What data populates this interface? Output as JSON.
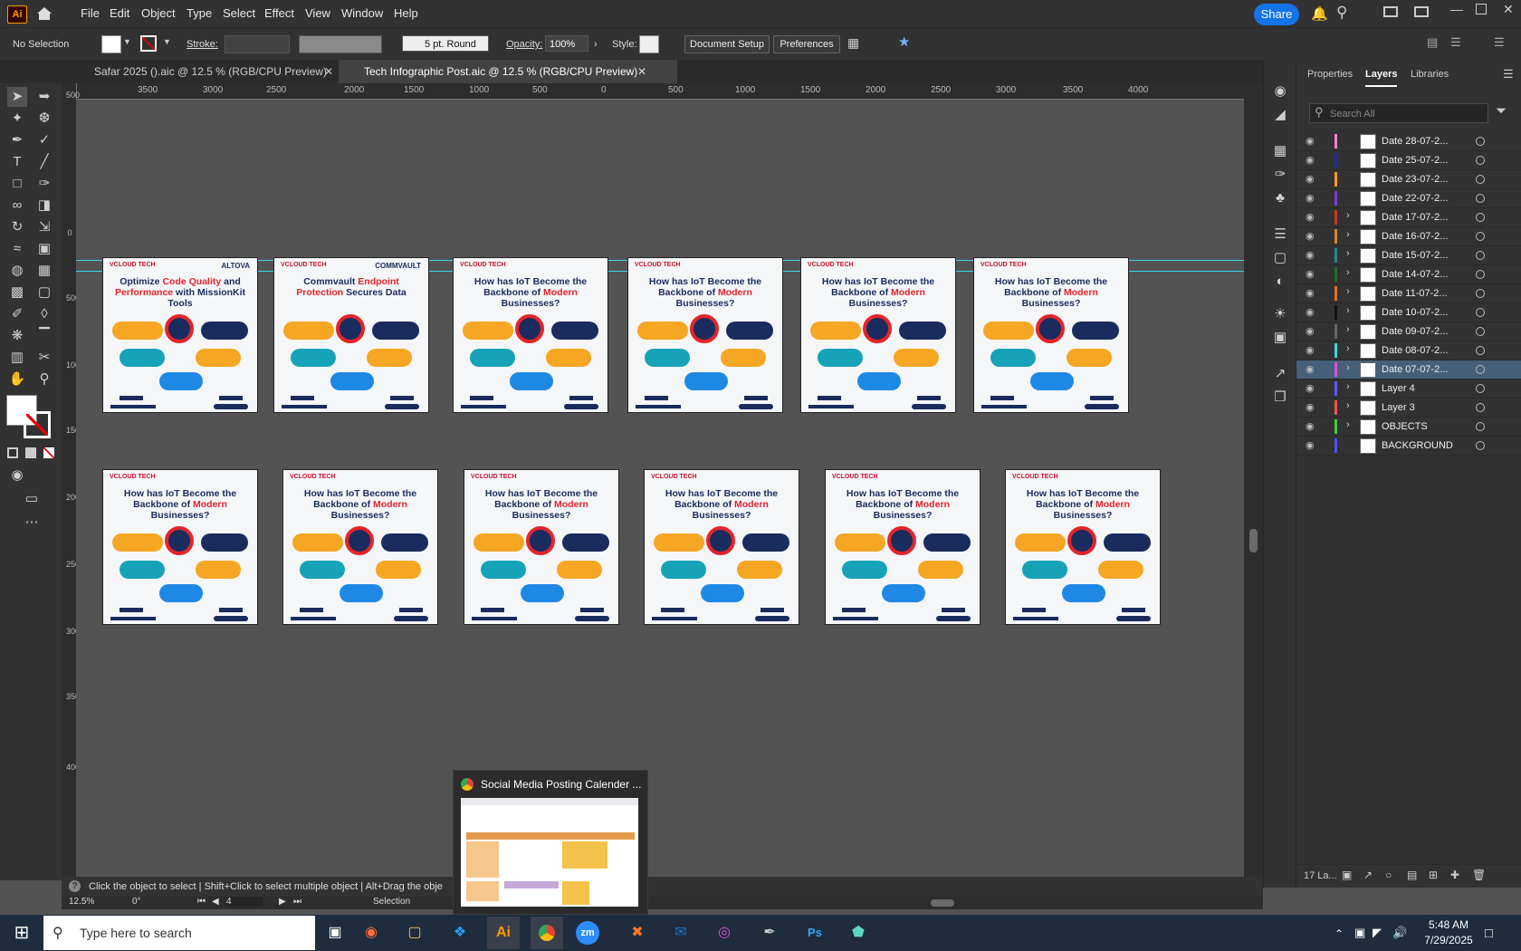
{
  "app": {
    "logo": "Ai"
  },
  "menu": [
    "File",
    "Edit",
    "Object",
    "Type",
    "Select",
    "Effect",
    "View",
    "Window",
    "Help"
  ],
  "header": {
    "share_label": "Share"
  },
  "control_bar": {
    "selection": "No Selection",
    "stroke_label": "Stroke:",
    "brush": "5 pt. Round",
    "opacity_label": "Opacity:",
    "opacity_value": "100%",
    "style_label": "Style:",
    "document_setup": "Document Setup",
    "preferences": "Preferences"
  },
  "tabs": [
    {
      "label": "Safar 2025 ().aic @ 12.5 % (RGB/CPU Preview)",
      "active": false
    },
    {
      "label": "Tech Infographic Post.aic @ 12.5 % (RGB/CPU Preview)",
      "active": true
    }
  ],
  "ruler_h": [
    "3500",
    "3000",
    "2500",
    "2000",
    "1500",
    "1000",
    "500",
    "0",
    "500",
    "1000",
    "1500",
    "2000",
    "2500",
    "3000",
    "3500",
    "4000"
  ],
  "ruler_v": [
    "500",
    "0",
    "500",
    "1000",
    "1500",
    "2000",
    "2500",
    "3000",
    "3500",
    "4000"
  ],
  "artboards_row1": [
    {
      "logo": "VCLOUD TECH",
      "brand": "ALTOVA",
      "title_a": "Optimize ",
      "title_red": "Code Quality",
      "title_b": " and ",
      "title_red2": "Performance",
      "title_c": " with MissionKit Tools"
    },
    {
      "logo": "VCLOUD TECH",
      "brand": "COMMVAULT",
      "title_a": "Commvault ",
      "title_red": "Endpoint Protection",
      "title_b": " Secures Data",
      "title_red2": "",
      "title_c": ""
    },
    {
      "logo": "VCLOUD TECH",
      "brand": "",
      "title_a": "How has IoT Become the Backbone of ",
      "title_red": "Modern",
      "title_b": " Businesses?",
      "title_red2": "",
      "title_c": ""
    },
    {
      "logo": "VCLOUD TECH",
      "brand": "",
      "title_a": "How has IoT Become the Backbone of ",
      "title_red": "Modern",
      "title_b": " Businesses?",
      "title_red2": "",
      "title_c": ""
    },
    {
      "logo": "VCLOUD TECH",
      "brand": "",
      "title_a": "How has IoT Become the Backbone of ",
      "title_red": "Modern",
      "title_b": " Businesses?",
      "title_red2": "",
      "title_c": ""
    },
    {
      "logo": "VCLOUD TECH",
      "brand": "",
      "title_a": "How has IoT Become the Backbone of ",
      "title_red": "Modern",
      "title_b": " Businesses?",
      "title_red2": "",
      "title_c": ""
    }
  ],
  "artboards_row2": [
    {
      "logo": "VCLOUD TECH",
      "title_a": "How has IoT Become the Backbone of ",
      "title_red": "Modern",
      "title_b": " Businesses?"
    },
    {
      "logo": "VCLOUD TECH",
      "title_a": "How has IoT Become the Backbone of ",
      "title_red": "Modern",
      "title_b": " Businesses?"
    },
    {
      "logo": "VCLOUD TECH",
      "title_a": "How has IoT Become the Backbone of ",
      "title_red": "Modern",
      "title_b": " Businesses?"
    },
    {
      "logo": "VCLOUD TECH",
      "title_a": "How has IoT Become the Backbone of ",
      "title_red": "Modern",
      "title_b": " Businesses?"
    },
    {
      "logo": "VCLOUD TECH",
      "title_a": "How has IoT Become the Backbone of ",
      "title_red": "Modern",
      "title_b": " Businesses?"
    },
    {
      "logo": "VCLOUD TECH",
      "title_a": "How has IoT Become the Backbone of ",
      "title_red": "Modern",
      "title_b": " Businesses?"
    }
  ],
  "panel": {
    "tabs": [
      "Properties",
      "Layers",
      "Libraries"
    ],
    "active_tab": "Layers",
    "search_placeholder": "Search All",
    "layers": [
      {
        "name": "Date 28-07-2...",
        "color": "#ff7fd0",
        "expand": false,
        "selected": false
      },
      {
        "name": "Date 25-07-2...",
        "color": "#1e2aa8",
        "expand": false,
        "selected": false
      },
      {
        "name": "Date 23-07-2...",
        "color": "#f29a24",
        "expand": false,
        "selected": false
      },
      {
        "name": "Date 22-07-2...",
        "color": "#7a3bd8",
        "expand": false,
        "selected": false
      },
      {
        "name": "Date 17-07-2...",
        "color": "#c8381f",
        "expand": true,
        "selected": false
      },
      {
        "name": "Date 16-07-2...",
        "color": "#d6862e",
        "expand": true,
        "selected": false
      },
      {
        "name": "Date 15-07-2...",
        "color": "#1e8c8c",
        "expand": true,
        "selected": false
      },
      {
        "name": "Date 14-07-2...",
        "color": "#1f6d2a",
        "expand": true,
        "selected": false
      },
      {
        "name": "Date 11-07-2...",
        "color": "#e8701a",
        "expand": true,
        "selected": false
      },
      {
        "name": "Date 10-07-2...",
        "color": "#111111",
        "expand": true,
        "selected": false
      },
      {
        "name": "Date 09-07-2...",
        "color": "#666666",
        "expand": true,
        "selected": false
      },
      {
        "name": "Date 08-07-2...",
        "color": "#3fd6d6",
        "expand": true,
        "selected": false
      },
      {
        "name": "Date 07-07-2...",
        "color": "#e04de0",
        "expand": true,
        "selected": true
      },
      {
        "name": "Layer 4",
        "color": "#5b5bff",
        "expand": true,
        "selected": false
      },
      {
        "name": "Layer 3",
        "color": "#ff4f4f",
        "expand": true,
        "selected": false
      },
      {
        "name": "OBJECTS",
        "color": "#3fcf3f",
        "expand": true,
        "selected": false
      },
      {
        "name": "BACKGROUND",
        "color": "#4f4fff",
        "expand": false,
        "selected": false
      }
    ],
    "layer_count": "17 La..."
  },
  "status": {
    "hint": "Click the object to select  |  Shift+Click to select multiple object  |  Alt+Drag the obje",
    "zoom": "12.5%",
    "angle": "0°",
    "artboard": "4",
    "tool": "Selection"
  },
  "popup": {
    "title": "Social Media Posting Calender ..."
  },
  "taskbar": {
    "search_placeholder": "Type here to search",
    "time": "5:48 AM",
    "date": "7/29/2025"
  }
}
